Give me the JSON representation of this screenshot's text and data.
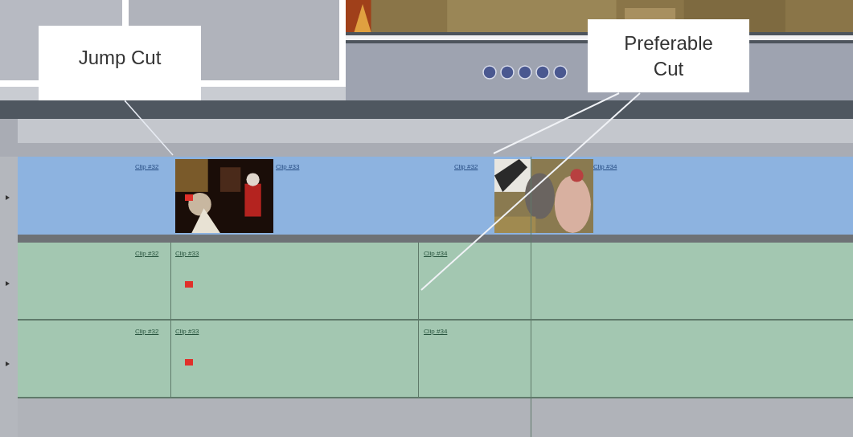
{
  "callouts": [
    {
      "text": "Jump Cut"
    },
    {
      "text": "Preferable Cut"
    }
  ],
  "timeline": {
    "video_track": {
      "clip_labels": [
        "Clip #32",
        "Clip #33",
        "Clip #32",
        "Clip #34"
      ]
    },
    "audio_tracks": [
      {
        "clip_labels": [
          "Clip #32",
          "Clip #33",
          "Clip #34"
        ]
      },
      {
        "clip_labels": [
          "Clip #32",
          "Clip #33",
          "Clip #34"
        ]
      }
    ]
  }
}
